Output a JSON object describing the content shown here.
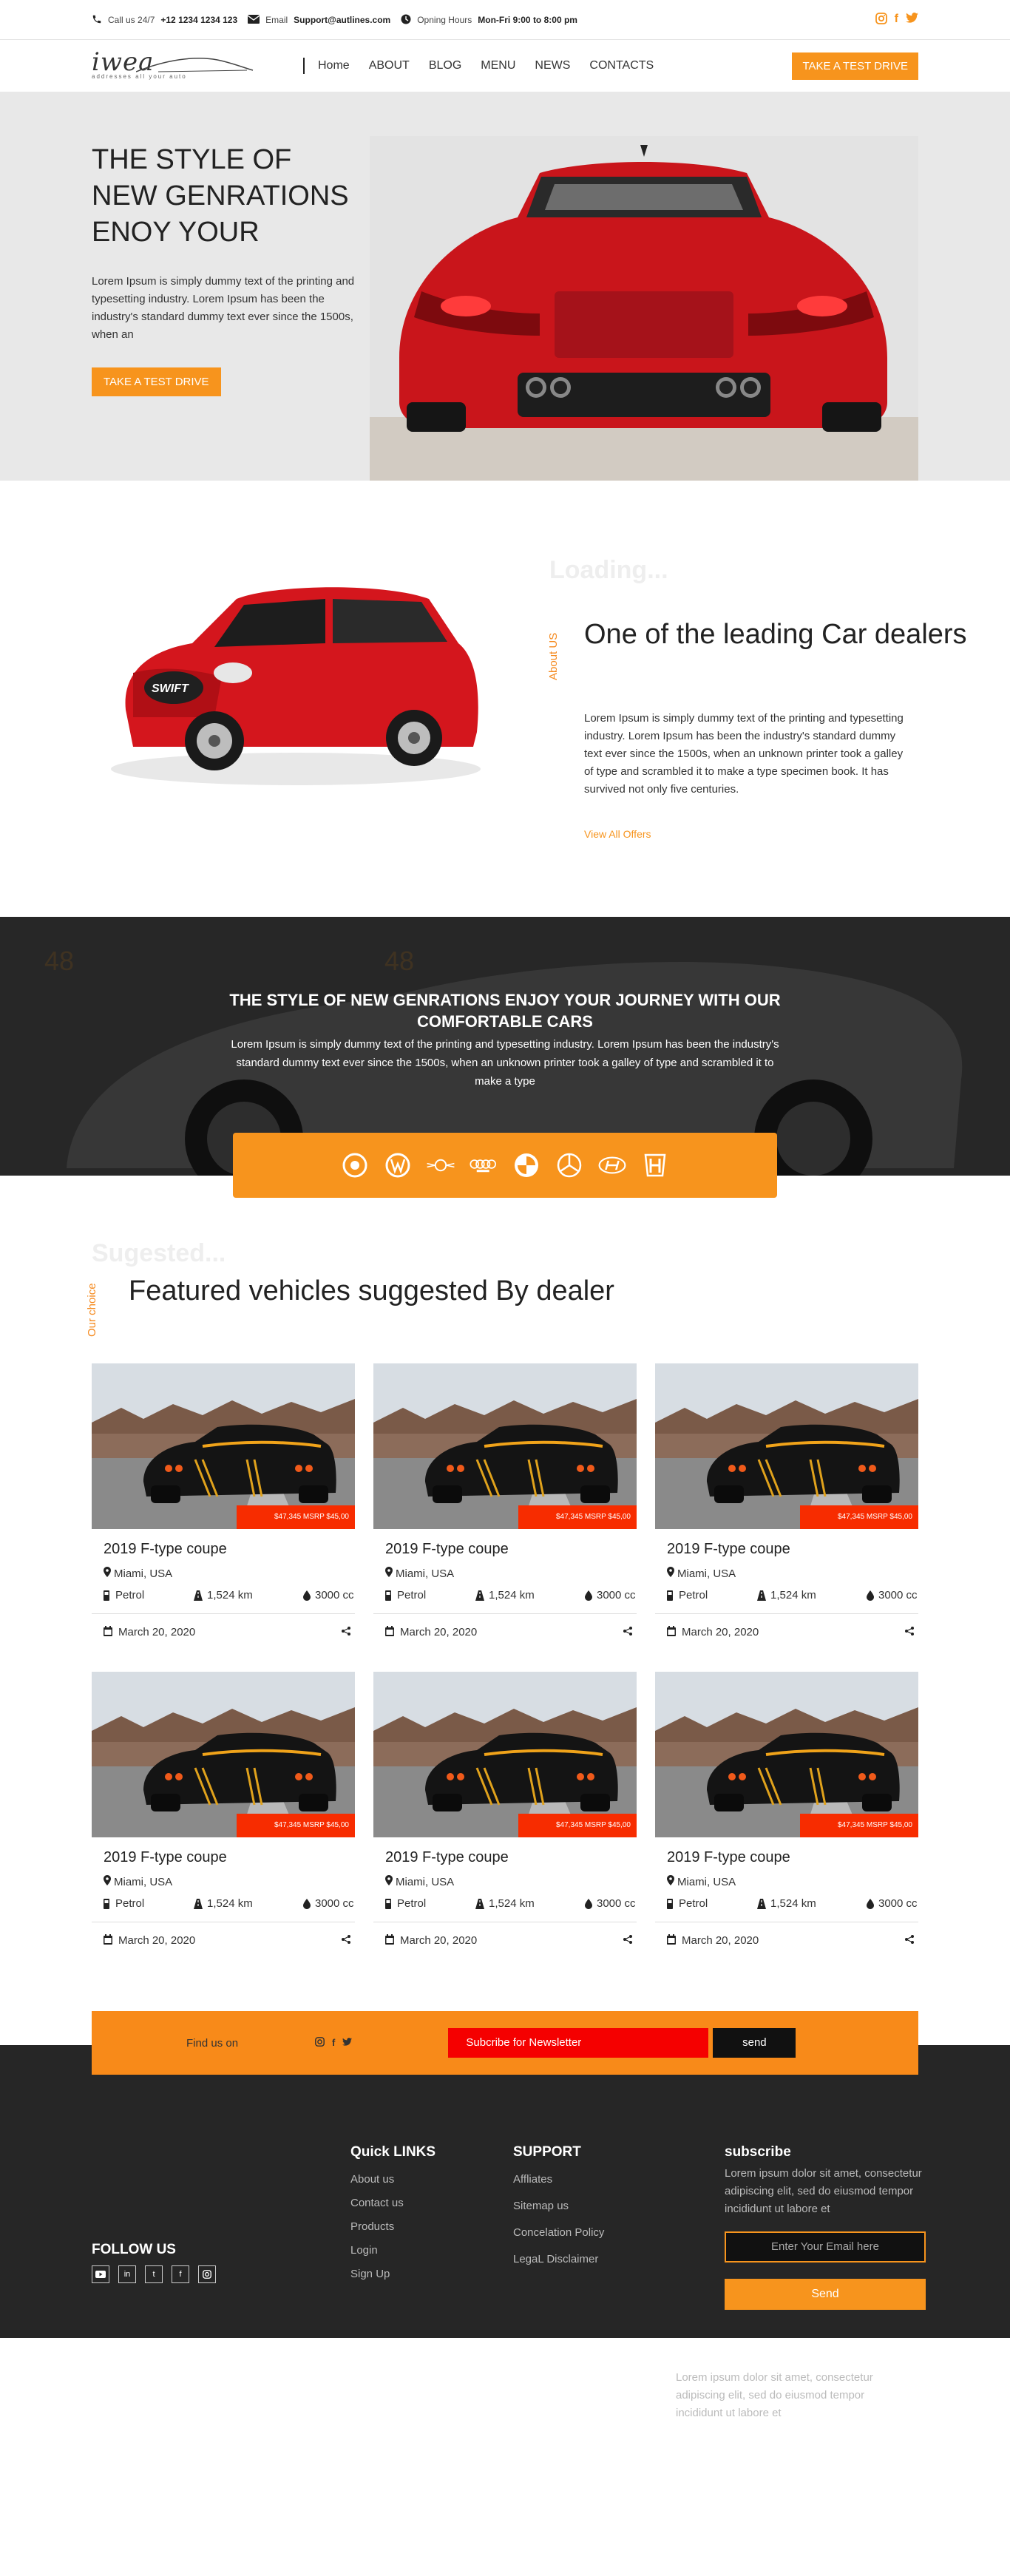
{
  "topbar": {
    "call_label": "Call us 24/7",
    "phone": "+12 1234 1234 123",
    "email_label": "Email",
    "email": "Support@autlines.com",
    "hours_label": "Opning Hours",
    "hours": "Mon-Fri 9:00 to 8:00 pm",
    "social_icons": [
      "instagram-icon",
      "facebook-icon",
      "twitter-icon"
    ]
  },
  "nav": {
    "logo_word": "iwea",
    "logo_tag": "addresses all your auto",
    "items": [
      "Home",
      "ABOUT",
      "BLOG",
      "MENU",
      "NEWS",
      "CONTACTS"
    ],
    "cta": "TAKE A TEST DRIVE"
  },
  "hero": {
    "title": "THE STYLE OF NEW GENRATIONS ENOY YOUR",
    "text": "Lorem Ipsum is simply dummy text of the printing and typesetting industry. Lorem Ipsum has been the industry's standard dummy text ever since the 1500s, when an",
    "button": "TAKE A TEST DRIVE"
  },
  "about": {
    "loading": "Loading...",
    "vertical_label": "About US",
    "title": "One of the leading Car dealers",
    "text": "Lorem Ipsum is simply dummy text of the printing and typesetting industry. Lorem Ipsum has been the industry's standard dummy text ever since the 1500s, when an unknown printer took a galley of type and scrambled it to make a type specimen book. It has survived not only five centuries.",
    "link": "View All Offers",
    "car_plate": "SWIFT"
  },
  "banner": {
    "title": "THE STYLE OF NEW GENRATIONS ENJOY YOUR JOURNEY WITH OUR COMFORTABLE CARS",
    "text": "Lorem Ipsum is simply dummy text of the printing and typesetting industry. Lorem Ipsum has been the industry's standard dummy text ever since the 1500s, when an unknown printer took a galley of type and scrambled it to make a type",
    "brands": [
      "porsche-logo",
      "volkswagen-logo",
      "mini-logo",
      "audi-logo",
      "bmw-logo",
      "mercedes-logo",
      "hyundai-logo",
      "honda-logo"
    ]
  },
  "featured": {
    "ghost": "Sugested...",
    "vertical_label": "Our choice",
    "title": "Featured vehicles suggested By dealer",
    "cards": [
      {
        "price": "$47,345  MSRP $45,00",
        "title": "2019 F-type coupe",
        "location": "Miami, USA",
        "fuel": "Petrol",
        "km": "1,524 km",
        "cc": "3000 cc",
        "date": "March 20, 2020"
      },
      {
        "price": "$47,345  MSRP $45,00",
        "title": "2019 F-type coupe",
        "location": "Miami, USA",
        "fuel": "Petrol",
        "km": "1,524 km",
        "cc": "3000 cc",
        "date": "March 20, 2020"
      },
      {
        "price": "$47,345  MSRP $45,00",
        "title": "2019 F-type coupe",
        "location": "Miami, USA",
        "fuel": "Petrol",
        "km": "1,524 km",
        "cc": "3000 cc",
        "date": "March 20, 2020"
      },
      {
        "price": "$47,345  MSRP $45,00",
        "title": "2019 F-type coupe",
        "location": "Miami, USA",
        "fuel": "Petrol",
        "km": "1,524 km",
        "cc": "3000 cc",
        "date": "March 20, 2020"
      },
      {
        "price": "$47,345  MSRP $45,00",
        "title": "2019 F-type coupe",
        "location": "Miami, USA",
        "fuel": "Petrol",
        "km": "1,524 km",
        "cc": "3000 cc",
        "date": "March 20, 2020"
      },
      {
        "price": "$47,345  MSRP $45,00",
        "title": "2019 F-type coupe",
        "location": "Miami, USA",
        "fuel": "Petrol",
        "km": "1,524 km",
        "cc": "3000 cc",
        "date": "March 20, 2020"
      }
    ]
  },
  "newsletter": {
    "find": "Find us on",
    "social_icons": [
      "instagram-icon",
      "facebook-icon",
      "twitter-icon"
    ],
    "subscribe": "Subcribe for Newsletter",
    "send": "send"
  },
  "footer": {
    "about_text": "Lorem ipsum dolor sit amet, consectetur adipiscing elit, sed do eiusmod tempor incididunt ut labore et",
    "follow_title": "FOLLOW US",
    "follow_icons": [
      "youtube-icon",
      "linkedin-icon",
      "twitter-icon",
      "facebook-icon",
      "instagram-icon"
    ],
    "quick_title": "Quick LINKS",
    "quick_links": [
      "About us",
      "Contact us",
      "Products",
      "Login",
      "Sign Up"
    ],
    "support_title": "SUPPORT",
    "support_links": [
      "Affliates",
      "Sitemap us",
      "Concelation Policy",
      "LegaL Disclaimer"
    ],
    "subscribe_title": "subscribe",
    "subscribe_text": "Lorem ipsum dolor sit amet, consectetur adipiscing elit, sed do eiusmod tempor incididunt ut labore et",
    "email_placeholder": "Enter Your Email here",
    "send": "Send"
  },
  "colors": {
    "accent": "#f7941d",
    "price_tag": "#f72c00",
    "footer_bg": "#262626"
  }
}
